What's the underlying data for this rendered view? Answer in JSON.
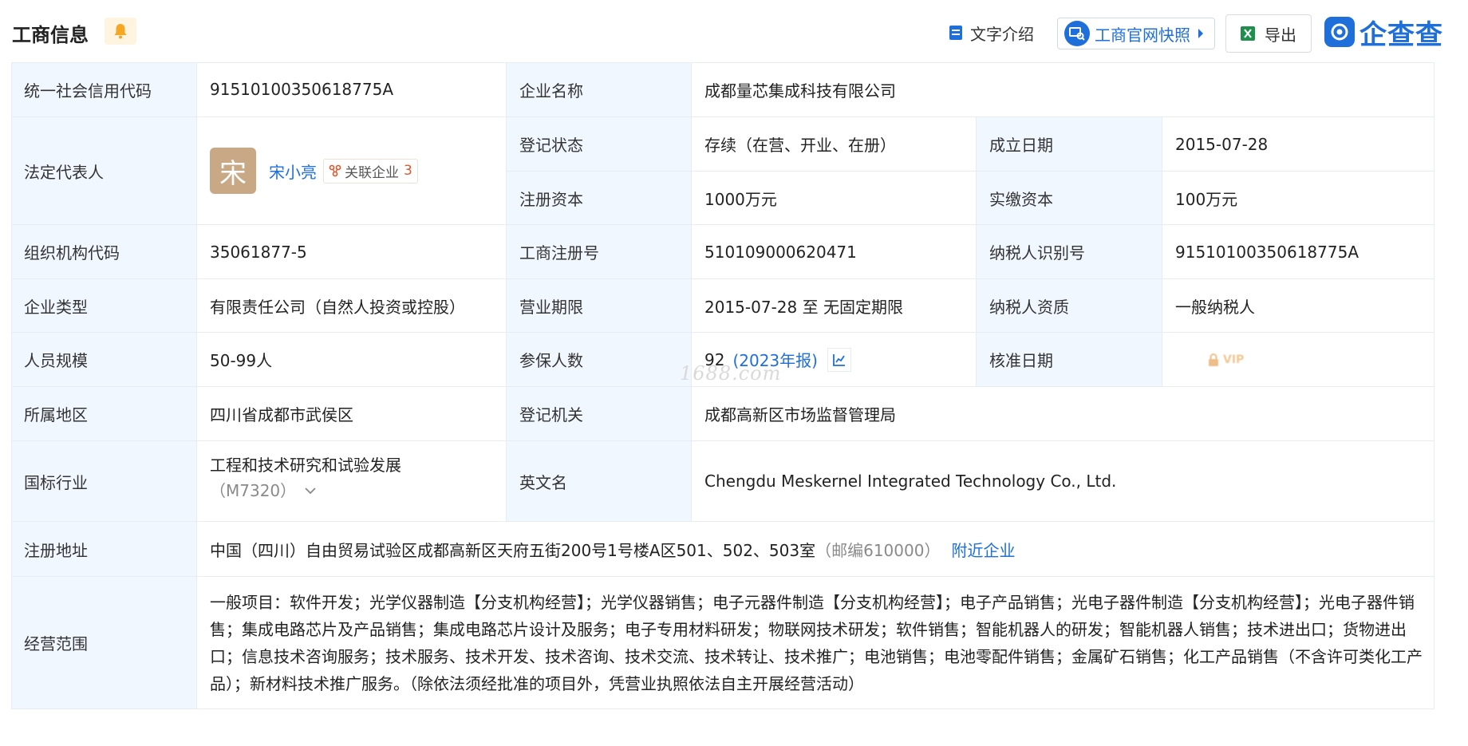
{
  "header": {
    "title": "工商信息",
    "tools": {
      "text_intro": "文字介绍",
      "official_snapshot": "工商官网快照",
      "export": "导出"
    },
    "brand": "企查查"
  },
  "rows": {
    "credit_code": {
      "label": "统一社会信用代码",
      "value": "91510100350618775A"
    },
    "company_name": {
      "label": "企业名称",
      "value": "成都量芯集成科技有限公司"
    },
    "legal_rep": {
      "label": "法定代表人",
      "avatar_char": "宋",
      "name": "宋小亮",
      "related_label": "关联企业",
      "related_count": "3"
    },
    "reg_status": {
      "label": "登记状态",
      "value": "存续（在营、开业、在册）"
    },
    "est_date": {
      "label": "成立日期",
      "value": "2015-07-28"
    },
    "reg_capital": {
      "label": "注册资本",
      "value": "1000万元"
    },
    "paid_capital": {
      "label": "实缴资本",
      "value": "100万元"
    },
    "org_code": {
      "label": "组织机构代码",
      "value": "35061877-5"
    },
    "biz_reg_no": {
      "label": "工商注册号",
      "value": "510109000620471"
    },
    "taxpayer_id": {
      "label": "纳税人识别号",
      "value": "91510100350618775A"
    },
    "company_type": {
      "label": "企业类型",
      "value": "有限责任公司（自然人投资或控股）"
    },
    "biz_term": {
      "label": "营业期限",
      "value": "2015-07-28 至 无固定期限"
    },
    "taxpayer_qual": {
      "label": "纳税人资质",
      "value": "一般纳税人"
    },
    "staff_size": {
      "label": "人员规模",
      "value": "50-99人"
    },
    "insured": {
      "label": "参保人数",
      "value": "92",
      "year_link": "(2023年报)"
    },
    "approve_date": {
      "label": "核准日期",
      "vip": "VIP"
    },
    "region": {
      "label": "所属地区",
      "value": "四川省成都市武侯区"
    },
    "reg_authority": {
      "label": "登记机关",
      "value": "成都高新区市场监督管理局"
    },
    "industry": {
      "label": "国标行业",
      "value": "工程和技术研究和试验发展",
      "code": "（M7320）"
    },
    "english_name": {
      "label": "英文名",
      "value": "Chengdu Meskernel Integrated Technology Co., Ltd."
    },
    "reg_address": {
      "label": "注册地址",
      "value": "中国（四川）自由贸易试验区成都高新区天府五街200号1号楼A区501、502、503室",
      "postcode": "（邮编610000）",
      "nearby": "附近企业"
    },
    "scope": {
      "label": "经营范围",
      "value": "一般项目：软件开发；光学仪器制造【分支机构经营】；光学仪器销售；电子元器件制造【分支机构经营】；电子产品销售；光电子器件制造【分支机构经营】；光电子器件销售；集成电路芯片及产品销售；集成电路芯片设计及服务；电子专用材料研发；物联网技术研发；软件销售；智能机器人的研发；智能机器人销售；技术进出口；货物进出口；信息技术咨询服务；技术服务、技术开发、技术咨询、技术交流、技术转让、技术推广；电池销售；电池零配件销售；金属矿石销售；化工产品销售（不含许可类化工产品）；新材料技术推广服务。（除依法须经批准的项目外，凭营业执照依法自主开展经营活动）"
    }
  },
  "watermark": "1688.com"
}
